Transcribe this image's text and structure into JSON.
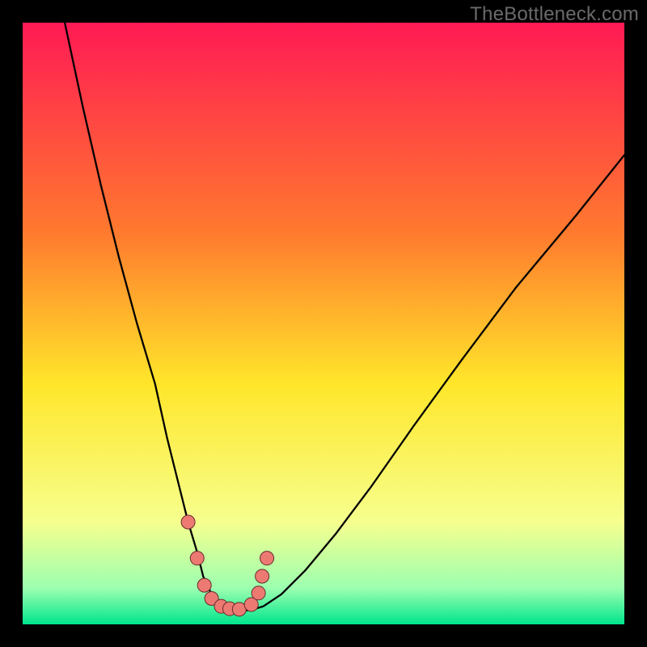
{
  "watermark": "TheBottleneck.com",
  "colors": {
    "frame": "#000000",
    "gradient_top": "#ff1a54",
    "gradient_mid1": "#ff7a2e",
    "gradient_mid2": "#ffe62a",
    "gradient_mid3": "#f6ff8e",
    "gradient_low": "#9cffb0",
    "gradient_bottom": "#00e58d",
    "curve": "#000000",
    "dot_fill": "#ec7a73",
    "dot_stroke": "#6a2b2b"
  },
  "chart_data": {
    "type": "line",
    "title": "",
    "xlabel": "",
    "ylabel": "",
    "xlim": [
      0,
      100
    ],
    "ylim": [
      0,
      100
    ],
    "series": [
      {
        "name": "bottleneck-curve",
        "x": [
          7,
          10,
          13,
          16,
          19,
          22,
          24,
          26,
          27.5,
          29,
          30,
          31.4,
          33,
          34.4,
          36,
          38,
          40,
          43,
          47,
          52,
          58,
          65,
          73,
          82,
          92,
          100
        ],
        "y": [
          100,
          86,
          73,
          61,
          50,
          40,
          31,
          23,
          17,
          12,
          8,
          5,
          3,
          2.4,
          2.2,
          2.4,
          3,
          5,
          9,
          15,
          23,
          33,
          44,
          56,
          68,
          78
        ]
      }
    ],
    "dots": [
      {
        "x": 27.5,
        "y": 17
      },
      {
        "x": 29.0,
        "y": 11
      },
      {
        "x": 30.2,
        "y": 6.5
      },
      {
        "x": 31.4,
        "y": 4.3
      },
      {
        "x": 33.0,
        "y": 3.0
      },
      {
        "x": 34.4,
        "y": 2.6
      },
      {
        "x": 36.0,
        "y": 2.5
      },
      {
        "x": 38.0,
        "y": 3.3
      },
      {
        "x": 39.2,
        "y": 5.2
      },
      {
        "x": 39.8,
        "y": 8.0
      },
      {
        "x": 40.6,
        "y": 11.0
      }
    ]
  }
}
